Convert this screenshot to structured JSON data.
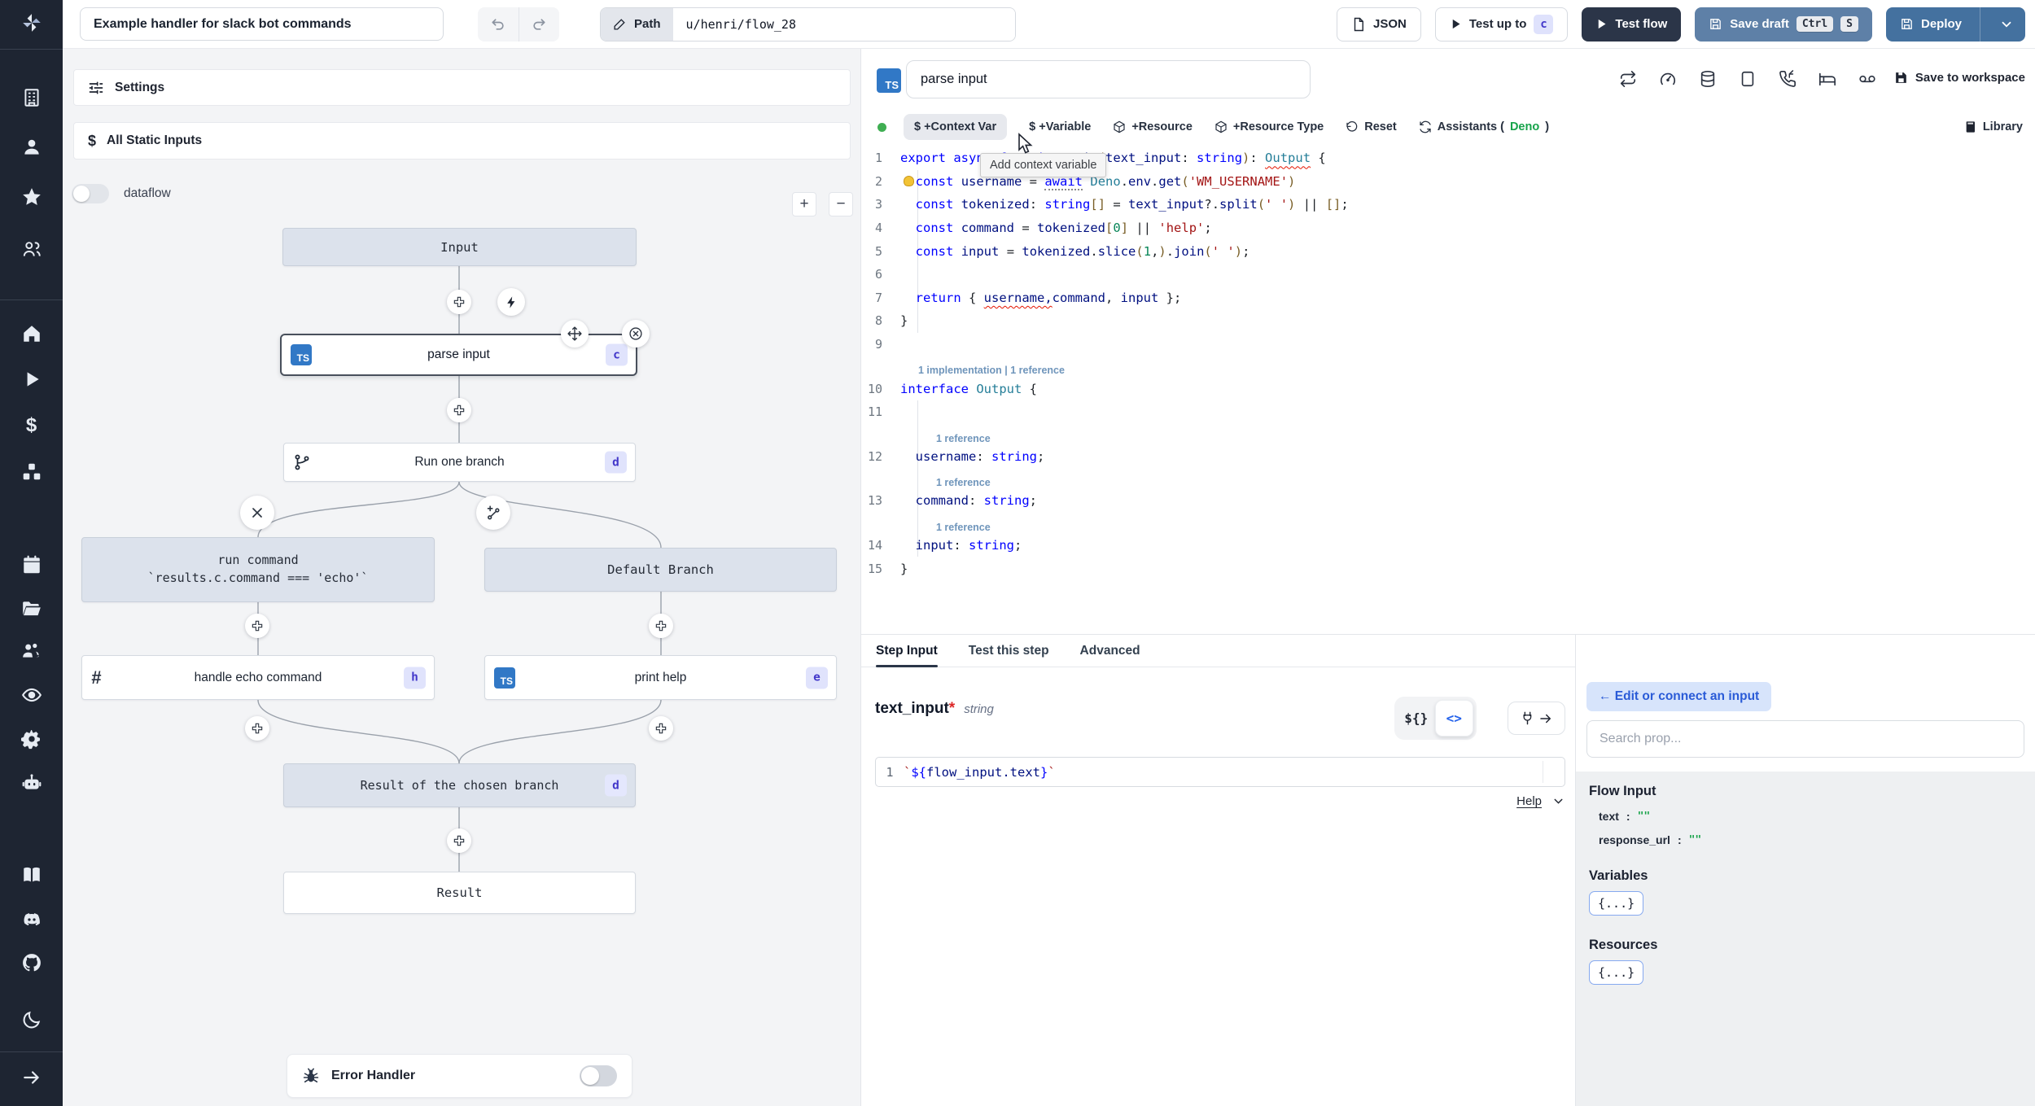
{
  "topbar": {
    "title_value": "Example handler for slack bot commands",
    "path_label": "Path",
    "path_value": "u/henri/flow_28",
    "json_label": "JSON",
    "test_up_to_label": "Test up to",
    "test_up_to_badge": "c",
    "test_flow_label": "Test flow",
    "save_draft_label": "Save draft",
    "save_draft_kbd": [
      "Ctrl",
      "S"
    ],
    "deploy_label": "Deploy"
  },
  "sidebar": {
    "icons": [
      "windmill-logo",
      "building",
      "user",
      "star",
      "users",
      "home",
      "play",
      "dollar",
      "cubes",
      "calendar",
      "folder",
      "users-gear",
      "eye",
      "gear",
      "robot",
      "book",
      "discord",
      "github",
      "moon",
      "arrow-right"
    ]
  },
  "flow": {
    "settings_label": "Settings",
    "static_inputs_label": "All Static Inputs",
    "dataflow_label": "dataflow",
    "zoom_in": "+",
    "zoom_out": "−",
    "nodes": {
      "input": {
        "label": "Input"
      },
      "parse_input": {
        "label": "parse input",
        "badge": "c",
        "lang": "TS"
      },
      "run_one_branch": {
        "label": "Run one branch",
        "badge": "d"
      },
      "run_command": {
        "label": "run command",
        "sublabel": "`results.c.command === 'echo'`"
      },
      "default_branch": {
        "label": "Default Branch"
      },
      "handle_echo": {
        "label": "handle echo command",
        "badge": "h",
        "icon": "#"
      },
      "print_help": {
        "label": "print help",
        "badge": "e",
        "lang": "TS"
      },
      "branch_result": {
        "label": "Result of the chosen branch",
        "badge": "d"
      },
      "result": {
        "label": "Result"
      }
    },
    "error_handler_label": "Error Handler"
  },
  "editor": {
    "lang_chip": "TS",
    "step_name": "parse input",
    "save_to_workspace": "Save to workspace",
    "toolbar": {
      "context_var": "$ +Context Var",
      "variable": "$ +Variable",
      "resource": "+Resource",
      "resource_type": "+Resource Type",
      "reset": "Reset",
      "assistants_prefix": "Assistants (",
      "assistants_lang": "Deno",
      "assistants_suffix": ")",
      "library": "Library"
    },
    "tooltip": "Add context variable",
    "code": {
      "rows": [
        {
          "n": "1",
          "tokens": [
            [
              "kw",
              "export"
            ],
            [
              "pl",
              " "
            ],
            [
              "kw",
              "async"
            ],
            [
              "pl",
              " "
            ],
            [
              "kw",
              "function"
            ],
            [
              "pl",
              " "
            ],
            [
              "id",
              "main"
            ],
            [
              "pa",
              "("
            ],
            [
              "id",
              "text_input"
            ],
            [
              "pl",
              ": "
            ],
            [
              "kw",
              "string"
            ],
            [
              "pa",
              ")"
            ],
            [
              "pl",
              ": "
            ],
            [
              "ty sq",
              "Output"
            ],
            [
              "pl",
              " {"
            ]
          ]
        },
        {
          "n": "2",
          "bulb": true,
          "tokens": [
            [
              "pl",
              "  "
            ],
            [
              "kw",
              "const"
            ],
            [
              "pl",
              " "
            ],
            [
              "id",
              "username"
            ],
            [
              "pl",
              " = "
            ],
            [
              "kw dot",
              "await"
            ],
            [
              "pl",
              " "
            ],
            [
              "ty",
              "Deno"
            ],
            [
              "pl",
              "."
            ],
            [
              "id",
              "env"
            ],
            [
              "pl",
              "."
            ],
            [
              "id",
              "get"
            ],
            [
              "pa",
              "("
            ],
            [
              "st",
              "'WM_USERNAME'"
            ],
            [
              "pa",
              ")"
            ]
          ]
        },
        {
          "n": "3",
          "tokens": [
            [
              "pl",
              "  "
            ],
            [
              "kw",
              "const"
            ],
            [
              "pl",
              " "
            ],
            [
              "id",
              "tokenized"
            ],
            [
              "pl",
              ": "
            ],
            [
              "kw",
              "string"
            ],
            [
              "pa",
              "[]"
            ],
            [
              "pl",
              " = "
            ],
            [
              "id",
              "text_input"
            ],
            [
              "pl",
              "?."
            ],
            [
              "id",
              "split"
            ],
            [
              "pa",
              "("
            ],
            [
              "st",
              "' '"
            ],
            [
              "pa",
              ")"
            ],
            [
              "pl",
              " || "
            ],
            [
              "pa",
              "[]"
            ],
            [
              "pl",
              ";"
            ]
          ]
        },
        {
          "n": "4",
          "tokens": [
            [
              "pl",
              "  "
            ],
            [
              "kw",
              "const"
            ],
            [
              "pl",
              " "
            ],
            [
              "id",
              "command"
            ],
            [
              "pl",
              " = "
            ],
            [
              "id",
              "tokenized"
            ],
            [
              "pa",
              "["
            ],
            [
              "nu",
              "0"
            ],
            [
              "pa",
              "]"
            ],
            [
              "pl",
              " || "
            ],
            [
              "st",
              "'help'"
            ],
            [
              "pl",
              ";"
            ]
          ]
        },
        {
          "n": "5",
          "tokens": [
            [
              "pl",
              "  "
            ],
            [
              "kw",
              "const"
            ],
            [
              "pl",
              " "
            ],
            [
              "id",
              "input"
            ],
            [
              "pl",
              " = "
            ],
            [
              "id",
              "tokenized"
            ],
            [
              "pl",
              "."
            ],
            [
              "id",
              "slice"
            ],
            [
              "pa",
              "("
            ],
            [
              "nu",
              "1"
            ],
            [
              "pl",
              ","
            ],
            [
              "pa",
              ")"
            ],
            [
              "pl",
              "."
            ],
            [
              "id",
              "join"
            ],
            [
              "pa",
              "("
            ],
            [
              "st",
              "' '"
            ],
            [
              "pa",
              ")"
            ],
            [
              "pl",
              ";"
            ]
          ]
        },
        {
          "n": "6",
          "tokens": []
        },
        {
          "n": "7",
          "tokens": [
            [
              "pl",
              "  "
            ],
            [
              "kw",
              "return"
            ],
            [
              "pl",
              " { "
            ],
            [
              "id sq",
              "username,"
            ],
            [
              "id",
              "command"
            ],
            [
              "pl",
              ", "
            ],
            [
              "id",
              "input"
            ],
            [
              "pl",
              " };"
            ]
          ]
        },
        {
          "n": "8",
          "tokens": [
            [
              "pl",
              "}"
            ]
          ]
        },
        {
          "n": "9",
          "tokens": []
        },
        {
          "lens": "1 implementation | 1 reference"
        },
        {
          "n": "10",
          "tokens": [
            [
              "kw",
              "interface"
            ],
            [
              "pl",
              " "
            ],
            [
              "ty",
              "Output"
            ],
            [
              "pl",
              " {"
            ]
          ]
        },
        {
          "n": "11",
          "tokens": []
        },
        {
          "lens": "1 reference",
          "indent": true
        },
        {
          "n": "12",
          "tokens": [
            [
              "pl",
              "  "
            ],
            [
              "id",
              "username"
            ],
            [
              "pl",
              ": "
            ],
            [
              "kw",
              "string"
            ],
            [
              "pl",
              ";"
            ]
          ]
        },
        {
          "lens": "1 reference",
          "indent": true
        },
        {
          "n": "13",
          "tokens": [
            [
              "pl",
              "  "
            ],
            [
              "id",
              "command"
            ],
            [
              "pl",
              ": "
            ],
            [
              "kw",
              "string"
            ],
            [
              "pl",
              ";"
            ]
          ]
        },
        {
          "lens": "1 reference",
          "indent": true
        },
        {
          "n": "14",
          "tokens": [
            [
              "pl",
              "  "
            ],
            [
              "id",
              "input"
            ],
            [
              "pl",
              ": "
            ],
            [
              "kw",
              "string"
            ],
            [
              "pl",
              ";"
            ]
          ]
        },
        {
          "n": "15",
          "tokens": [
            [
              "pl",
              "}"
            ]
          ]
        }
      ]
    }
  },
  "step_panel": {
    "tabs": [
      "Step Input",
      "Test this step",
      "Advanced"
    ],
    "field_name": "text_input",
    "field_required": "*",
    "field_type": "string",
    "toggle_expr": "${}",
    "toggle_code": "<>",
    "expr_line_no": "1",
    "expr_tokens": [
      [
        "st",
        "`"
      ],
      [
        "kw",
        "${"
      ],
      [
        "id",
        "flow_input.text"
      ],
      [
        "kw",
        "}"
      ],
      [
        "st",
        "`"
      ]
    ],
    "help_label": "Help"
  },
  "connect_panel": {
    "back_button": "← Edit or connect an input",
    "search_placeholder": "Search prop...",
    "flow_input_title": "Flow Input",
    "props": [
      {
        "key": "text",
        "colon": ":",
        "value": "\"\""
      },
      {
        "key": "response_url",
        "colon": ":",
        "value": "\"\""
      }
    ],
    "variables_title": "Variables",
    "resources_title": "Resources",
    "object_chip": "{...}"
  },
  "colors": {
    "accent_blue": "#44719f",
    "slate_button": "#5e80a7",
    "dark_button": "#2b3548",
    "badge_bg": "#dfe2fc",
    "badge_text": "#4338ca",
    "ts_blue": "#3178c6",
    "green_ok": "#3fae52",
    "string_green": "#18a34a"
  }
}
